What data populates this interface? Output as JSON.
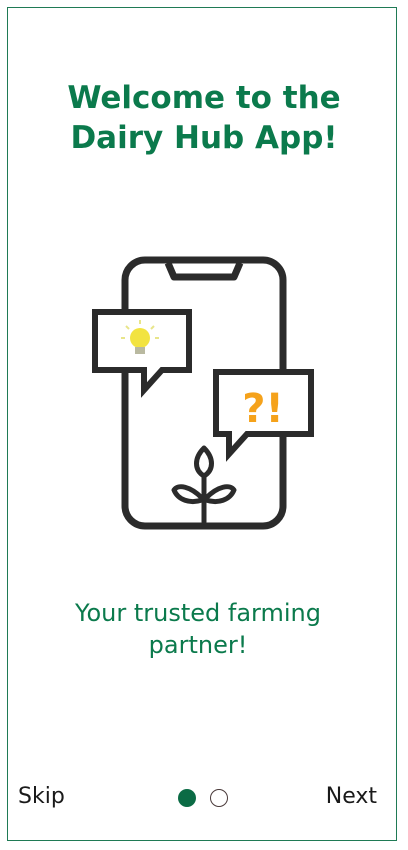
{
  "onboarding": {
    "title_line1": "Welcome to the",
    "title_line2": "Dairy Hub App!",
    "tagline_line1": "Your trusted farming",
    "tagline_line2": "partner!",
    "illustration_icon": "phone-with-ideas-icon",
    "bubble_left_symbol": "lightbulb-icon",
    "bubble_right_text": "?!",
    "plant_icon": "sprout-icon"
  },
  "footer": {
    "skip_label": "Skip",
    "next_label": "Next",
    "pager": {
      "current_page": 1,
      "total_pages": 2
    }
  },
  "colors": {
    "brand_green": "#0b7a4c",
    "dot_active": "#0b6b45",
    "icon_dark": "#2b2b2b",
    "bulb_yellow": "#f2e340",
    "accent_orange": "#f5a21b"
  }
}
